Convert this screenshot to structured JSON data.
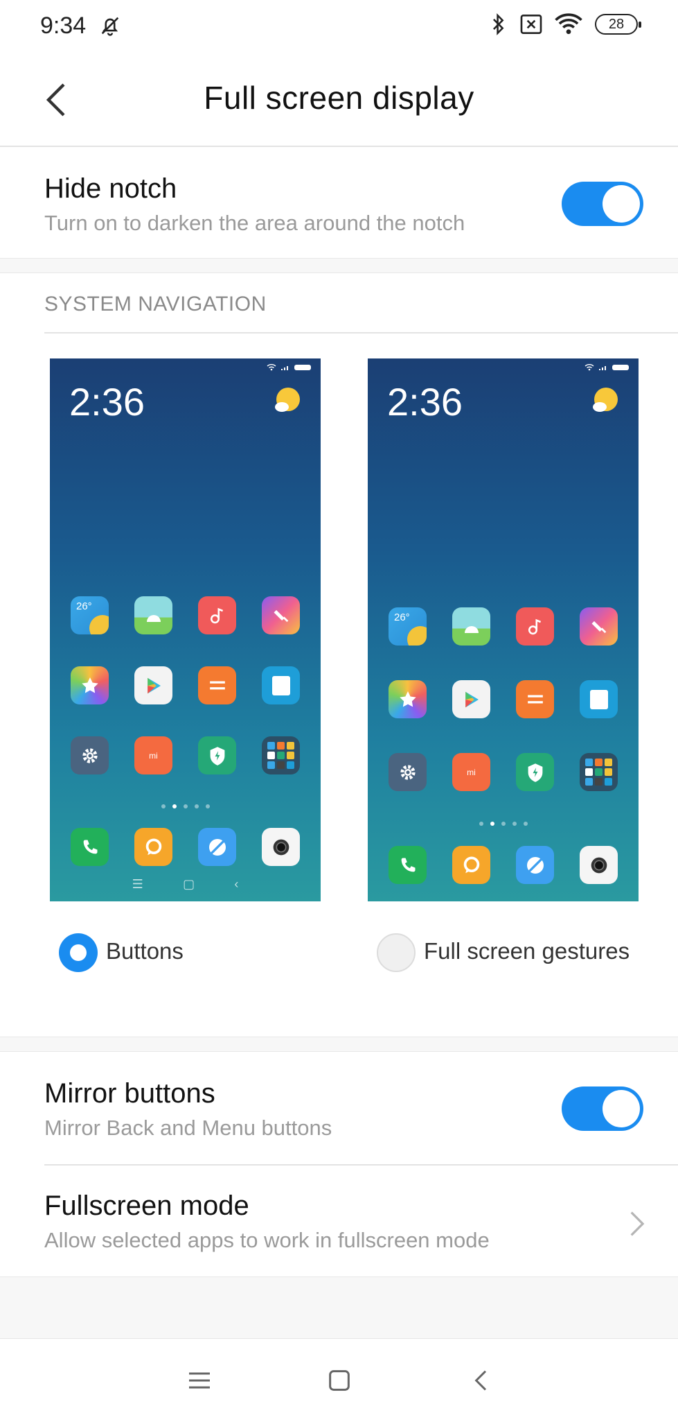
{
  "status_bar": {
    "time": "9:34",
    "battery": "28",
    "icons": [
      "bell-off-icon",
      "bluetooth-icon",
      "sim-x-icon",
      "wifi-icon",
      "battery-icon"
    ]
  },
  "header": {
    "title": "Full screen display",
    "back_icon": "back-arrow-icon"
  },
  "hide_notch": {
    "title": "Hide notch",
    "subtitle": "Turn on to darken the area around the notch",
    "enabled": true
  },
  "system_navigation": {
    "label": "SYSTEM NAVIGATION",
    "preview_time": "2:36",
    "weather_temp": "26°",
    "options": [
      {
        "label": "Buttons",
        "selected": true
      },
      {
        "label": "Full screen gestures",
        "selected": false
      }
    ]
  },
  "mirror_buttons": {
    "title": "Mirror buttons",
    "subtitle": "Mirror Back and Menu buttons",
    "enabled": true
  },
  "fullscreen_mode": {
    "title": "Fullscreen mode",
    "subtitle": "Allow selected apps to work in fullscreen mode"
  },
  "nav_bar": {
    "icons": [
      "menu-icon",
      "home-icon",
      "back-icon"
    ]
  },
  "colors": {
    "accent": "#1a8cf0",
    "subtitle_text": "#9a9a9a",
    "section_text": "#8a8a8a"
  }
}
